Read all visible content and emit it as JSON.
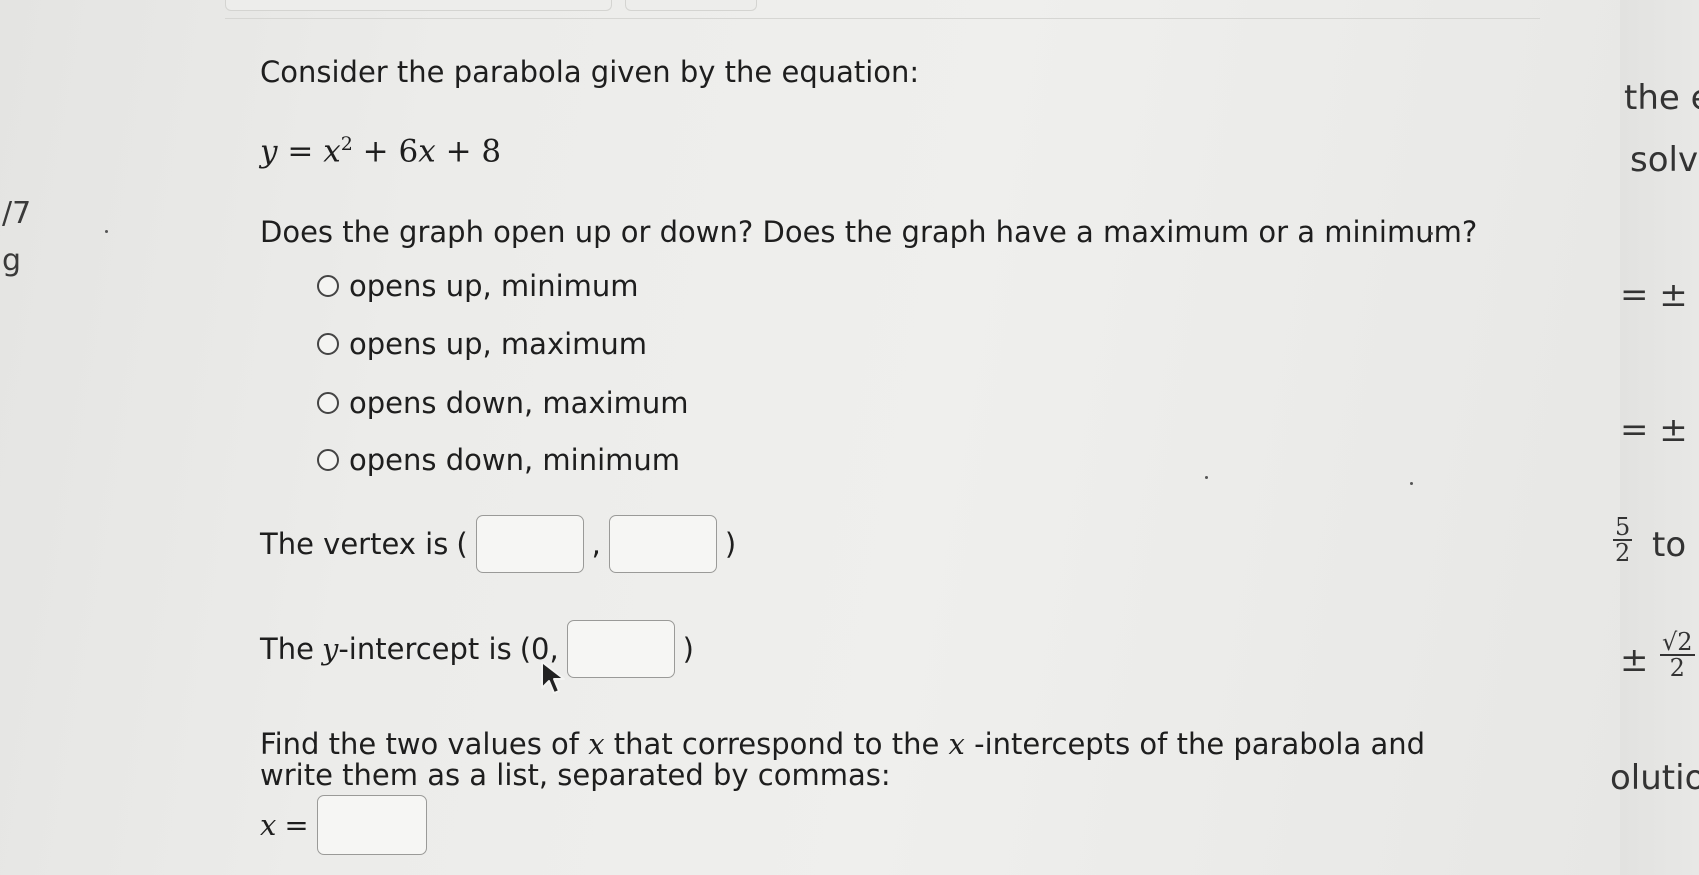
{
  "question": {
    "intro": "Consider the parabola given by the equation:",
    "equation": {
      "lhs": "y",
      "eq": "=",
      "x": "x",
      "exp": "2",
      "rest": "+ 6",
      "x2": "x",
      "tail": "+ 8"
    },
    "prompt": "Does the graph open up or down? Does the graph have a maximum or a minimum?",
    "options": [
      "opens up, minimum",
      "opens up, maximum",
      "opens down, maximum",
      "opens down, minimum"
    ],
    "vertex": {
      "label": "The vertex is",
      "open": "(",
      "sep": ",",
      "close": ")",
      "x_value": "",
      "y_value": ""
    },
    "yintercept": {
      "label_before": "The",
      "var": "y",
      "label_after": "-intercept is",
      "prefix": "(0,",
      "close": ")",
      "value": ""
    },
    "xintercepts": {
      "line1_a": "Find the two values of",
      "var1": "x",
      "line1_b": "that correspond to the",
      "var2": "x",
      "line1_c": "-intercepts of the parabola and",
      "line2": "write them as a list, separated by commas:",
      "answer_var": "x",
      "answer_eq": "=",
      "value": ""
    }
  },
  "left_fragments": [
    "/7",
    "g"
  ],
  "right_fragments": {
    "the": "the e",
    "solv": "solv",
    "pm1": "= ±",
    "pm2": "= ±",
    "frac_num": "5",
    "frac_den": "2",
    "to": "to l",
    "pm3": "±",
    "sqrt_num": "√2",
    "sqrt_den": "2",
    "solutio": "olutio"
  }
}
